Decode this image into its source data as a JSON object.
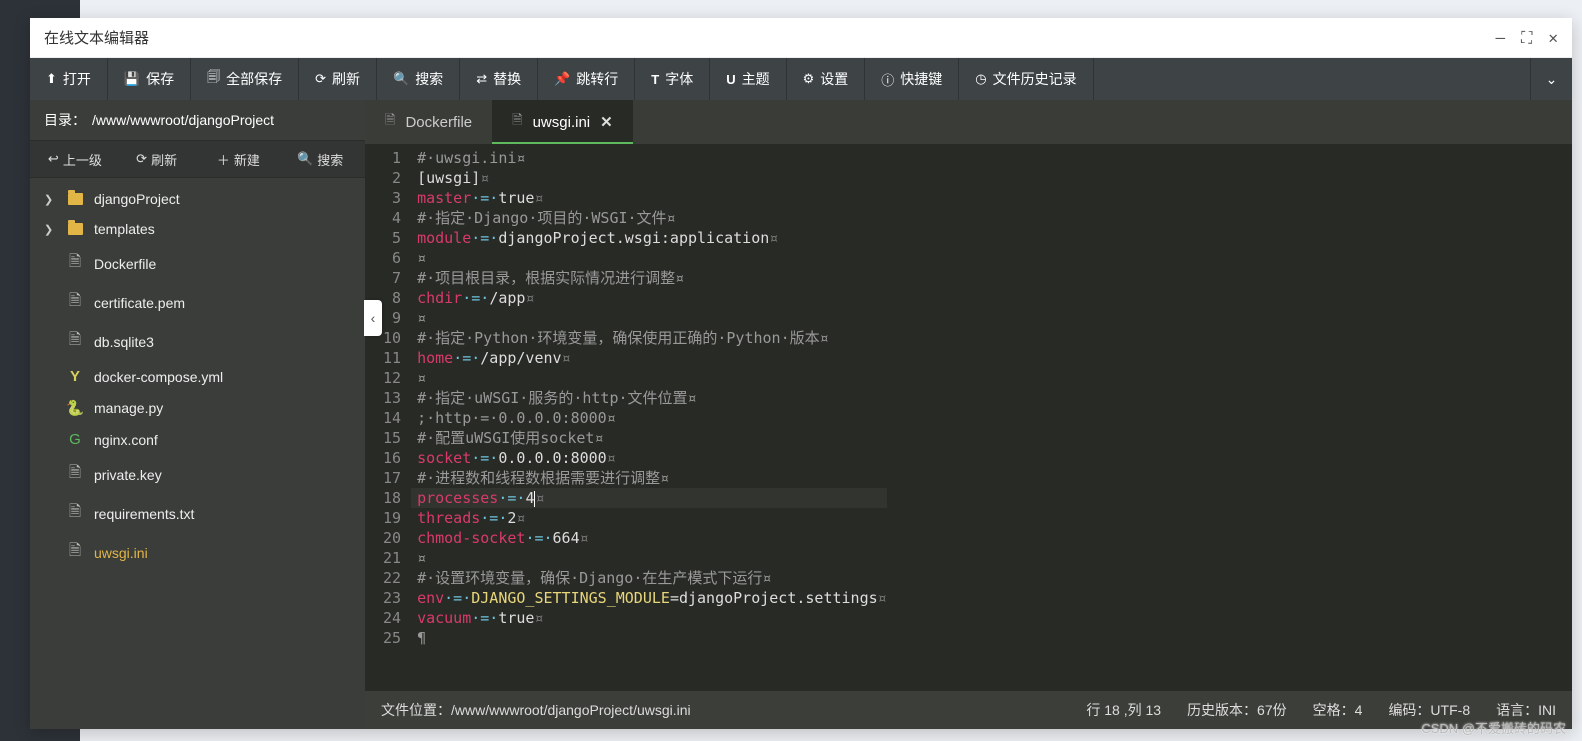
{
  "window": {
    "title": "在线文本编辑器"
  },
  "toolbar": {
    "open": "打开",
    "save": "保存",
    "saveall": "全部保存",
    "refresh": "刷新",
    "search": "搜索",
    "replace": "替换",
    "goto": "跳转行",
    "font": "字体",
    "theme": "主题",
    "settings": "设置",
    "shortcut": "快捷键",
    "history": "文件历史记录"
  },
  "sidebar": {
    "dir_label": "目录：",
    "dir_path": "/www/wwwroot/djangoProject",
    "up": "上一级",
    "refresh": "刷新",
    "new": "新建",
    "search": "搜索",
    "items": [
      {
        "type": "folder",
        "name": "djangoProject",
        "expandable": true
      },
      {
        "type": "folder",
        "name": "templates",
        "expandable": true
      },
      {
        "type": "file",
        "name": "Dockerfile",
        "icon": "file"
      },
      {
        "type": "file",
        "name": "certificate.pem",
        "icon": "file"
      },
      {
        "type": "file",
        "name": "db.sqlite3",
        "icon": "file"
      },
      {
        "type": "file",
        "name": "docker-compose.yml",
        "icon": "yml"
      },
      {
        "type": "file",
        "name": "manage.py",
        "icon": "py"
      },
      {
        "type": "file",
        "name": "nginx.conf",
        "icon": "conf"
      },
      {
        "type": "file",
        "name": "private.key",
        "icon": "file"
      },
      {
        "type": "file",
        "name": "requirements.txt",
        "icon": "file"
      },
      {
        "type": "file",
        "name": "uwsgi.ini",
        "icon": "file",
        "active": true
      }
    ]
  },
  "tabs": [
    {
      "label": "Dockerfile",
      "active": false,
      "closable": false
    },
    {
      "label": "uwsgi.ini",
      "active": true,
      "closable": true
    }
  ],
  "code": {
    "lines": [
      {
        "n": 1,
        "t": "cmt",
        "text": "#·uwsgi.ini¤"
      },
      {
        "n": 2,
        "t": "sec",
        "text": "[uwsgi]",
        "tail": "¤"
      },
      {
        "n": 3,
        "t": "kv",
        "k": "master",
        "o": "·=·",
        "v": "true",
        "tail": "¤"
      },
      {
        "n": 4,
        "t": "cmt",
        "text": "#·指定·Django·项目的·WSGI·文件¤"
      },
      {
        "n": 5,
        "t": "kv",
        "k": "module",
        "o": "·=·",
        "v": "djangoProject.wsgi:application",
        "tail": "¤"
      },
      {
        "n": 6,
        "t": "cmt",
        "text": "¤"
      },
      {
        "n": 7,
        "t": "cmt",
        "text": "#·项目根目录，根据实际情况进行调整¤"
      },
      {
        "n": 8,
        "t": "kv",
        "k": "chdir",
        "o": "·=·",
        "v": "/app",
        "tail": "¤"
      },
      {
        "n": 9,
        "t": "cmt",
        "text": "¤"
      },
      {
        "n": 10,
        "t": "cmt",
        "text": "#·指定·Python·环境变量，确保使用正确的·Python·版本¤"
      },
      {
        "n": 11,
        "t": "kv",
        "k": "home",
        "o": "·=·",
        "v": "/app/venv",
        "tail": "¤"
      },
      {
        "n": 12,
        "t": "cmt",
        "text": "¤"
      },
      {
        "n": 13,
        "t": "cmt",
        "text": "#·指定·uWSGI·服务的·http·文件位置¤"
      },
      {
        "n": 14,
        "t": "cmt",
        "text": ";·http·=·0.0.0.0:8000¤"
      },
      {
        "n": 15,
        "t": "cmt",
        "text": "#·配置uWSGI使用socket¤"
      },
      {
        "n": 16,
        "t": "kv",
        "k": "socket",
        "o": "·=·",
        "v": "0.0.0.0:8000",
        "tail": "¤"
      },
      {
        "n": 17,
        "t": "cmt",
        "text": "#·进程数和线程数根据需要进行调整¤"
      },
      {
        "n": 18,
        "t": "kv",
        "k": "processes",
        "o": "·=·",
        "v": "4",
        "tail": "¤",
        "hl": true,
        "cursor": true
      },
      {
        "n": 19,
        "t": "kv",
        "k": "threads",
        "o": "·=·",
        "v": "2",
        "tail": "¤"
      },
      {
        "n": 20,
        "t": "kv",
        "k": "chmod-socket",
        "o": "·=·",
        "v": "664",
        "tail": "¤"
      },
      {
        "n": 21,
        "t": "cmt",
        "text": "¤"
      },
      {
        "n": 22,
        "t": "cmt",
        "text": "#·设置环境变量，确保·Django·在生产模式下运行¤"
      },
      {
        "n": 23,
        "t": "env",
        "k": "env",
        "o": "·=·",
        "ek": "DJANGO_SETTINGS_MODULE",
        "ev": "=djangoProject.settings",
        "tail": "¤"
      },
      {
        "n": 24,
        "t": "kv",
        "k": "vacuum",
        "o": "·=·",
        "v": "true",
        "tail": "¤"
      },
      {
        "n": 25,
        "t": "cmt",
        "text": "¶"
      }
    ]
  },
  "status": {
    "path_label": "文件位置：",
    "path": "/www/wwwroot/djangoProject/uwsgi.ini",
    "pos": "行 18 ,列 13",
    "hist": "历史版本：67份",
    "spaces": "空格：4",
    "enc": "编码：UTF-8",
    "lang": "语言：INI"
  },
  "watermark": "CSDN @不爱搬砖的码农"
}
